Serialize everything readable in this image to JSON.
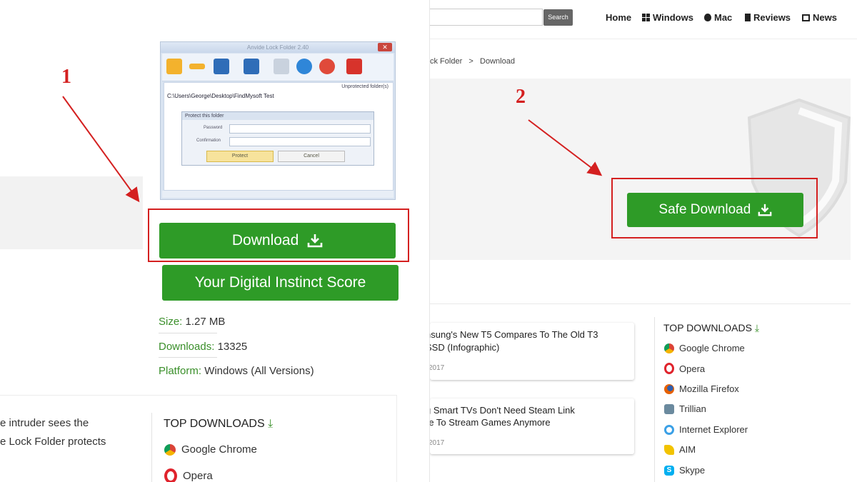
{
  "annotations": {
    "step1": "1",
    "step2": "2",
    "color": "#d42020"
  },
  "left": {
    "app_window": {
      "title": "Anvide Lock Folder 2.40",
      "unprotected_label": "Unprotected folder(s)",
      "folder_path": "C:\\Users\\George\\Desktop\\FindMysoft Test",
      "dialog": {
        "title": "Protect this folder",
        "password_label": "Password",
        "confirmation_label": "Confirmation",
        "protect_label": "Protect",
        "cancel_label": "Cancel"
      }
    },
    "download_button": {
      "label": "Download",
      "icon": "download-icon",
      "color": "#2e9b27"
    },
    "score_button": {
      "label": "Your Digital Instinct Score"
    },
    "meta": {
      "size_key": "Size:",
      "size_val": "1.27 MB",
      "downloads_key": "Downloads:",
      "downloads_val": "13325",
      "platform_key": "Platform:",
      "platform_val": "Windows (All Versions)"
    },
    "description": {
      "line1": "e intruder sees the",
      "line2": "e Lock Folder protects"
    },
    "top_downloads": {
      "heading": "TOP DOWNLOADS",
      "items": [
        "Google Chrome",
        "Opera"
      ]
    }
  },
  "right": {
    "search": {
      "button": "Search"
    },
    "nav": [
      "Home",
      "Windows",
      "Mac",
      "Reviews",
      "News"
    ],
    "breadcrumb": {
      "prev": "ck Folder",
      "sep": ">",
      "current": "Download"
    },
    "safe_download_button": {
      "label": "Safe Download",
      "icon": "download-icon"
    },
    "articles": [
      {
        "title_line1": "nsung's New T5 Compares To The Old T3",
        "title_line2": "SSD (Infographic)",
        "date": "2017"
      },
      {
        "title_line1": "g Smart TVs Don't Need Steam Link",
        "title_line2": "re To Stream Games Anymore",
        "date": "2017"
      }
    ],
    "top_downloads": {
      "heading": "TOP DOWNLOADS",
      "items": [
        "Google Chrome",
        "Opera",
        "Mozilla Firefox",
        "Trillian",
        "Internet Explorer",
        "AIM",
        "Skype"
      ]
    }
  }
}
